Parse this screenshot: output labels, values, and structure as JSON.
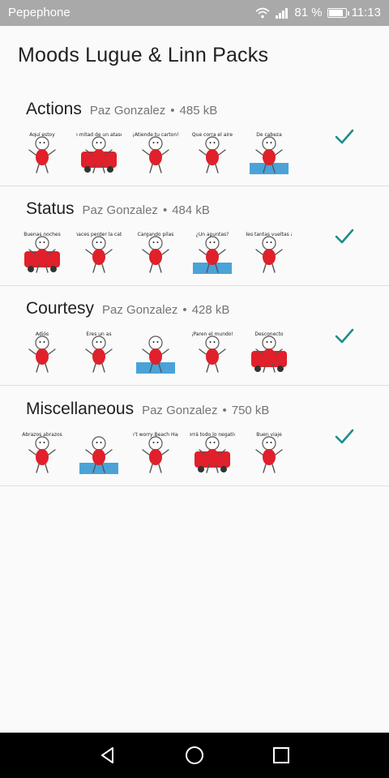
{
  "status_bar": {
    "carrier": "Pepephone",
    "battery": "81 %",
    "time": "11:13"
  },
  "page": {
    "title": "Moods Lugue & Linn Packs"
  },
  "packs": [
    {
      "name": "Actions",
      "author": "Paz Gonzalez",
      "size": "485 kB",
      "stickers": [
        {
          "text": "Aquí estoy"
        },
        {
          "text": "En mitad de un atasco"
        },
        {
          "text": "¡Atiende tu carton!"
        },
        {
          "text": "Que corra el aire"
        },
        {
          "text": "De cabeza"
        }
      ]
    },
    {
      "name": "Status",
      "author": "Paz Gonzalez",
      "size": "484 kB",
      "stickers": [
        {
          "text": "Buenas noches"
        },
        {
          "text": "Me haces perder la cabeza"
        },
        {
          "text": "Cargando pilas"
        },
        {
          "text": "¿Un apuntas?"
        },
        {
          "text": "No le des tantas vueltas al coco"
        }
      ]
    },
    {
      "name": "Courtesy",
      "author": "Paz Gonzalez",
      "size": "428 kB",
      "stickers": [
        {
          "text": "Adiós"
        },
        {
          "text": "Eres un as"
        },
        {
          "text": ""
        },
        {
          "text": "¡Paren el mundo!"
        },
        {
          "text": "Desconecto"
        }
      ]
    },
    {
      "name": "Miscellaneous",
      "author": "Paz Gonzalez",
      "size": "750 kB",
      "stickers": [
        {
          "text": "Abrazos abrazos"
        },
        {
          "text": ""
        },
        {
          "text": "Don't worry Beach Happy"
        },
        {
          "text": "Borrá todo lo negativo"
        },
        {
          "text": "Buen viaje"
        }
      ]
    }
  ],
  "icons": {
    "check": "check-icon",
    "back": "back-icon",
    "home": "home-icon",
    "recents": "recents-icon"
  },
  "colors": {
    "accent": "#1e8c8c",
    "sticker_red": "#e0202a",
    "status_bar": "#a9a9a9"
  }
}
